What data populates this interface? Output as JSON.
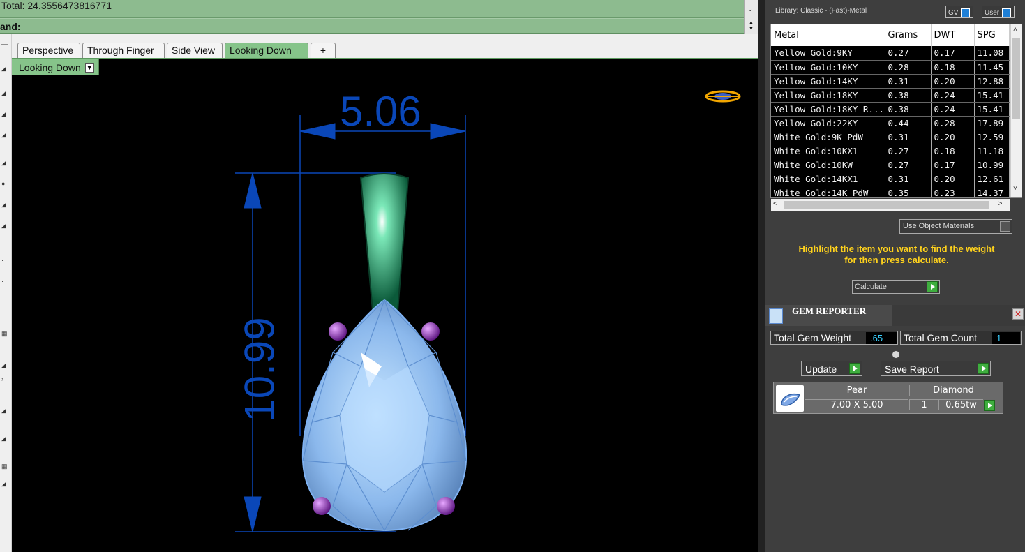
{
  "command_history": {
    "text": "Total: 24.3556473816771"
  },
  "command_line": {
    "label": "and:",
    "value": ""
  },
  "view_tabs": [
    {
      "label": "Perspective",
      "active": false
    },
    {
      "label": "Through Finger",
      "active": false
    },
    {
      "label": "Side View",
      "active": false
    },
    {
      "label": "Looking Down",
      "active": true
    },
    {
      "label": "+",
      "active": false
    }
  ],
  "viewport": {
    "label": "Looking Down",
    "dimension_width": "5.06",
    "dimension_height": "10.99"
  },
  "library": {
    "title": "Library: Classic - (Fast)-Metal",
    "gv_label": "GV",
    "user_label": "User"
  },
  "metal_table": {
    "columns": [
      "Metal",
      "Grams",
      "DWT",
      "SPG"
    ],
    "rows": [
      [
        "Yellow Gold:9KY",
        "0.27",
        "0.17",
        "11.08"
      ],
      [
        "Yellow Gold:10KY",
        "0.28",
        "0.18",
        "11.45"
      ],
      [
        "Yellow Gold:14KY",
        "0.31",
        "0.20",
        "12.88"
      ],
      [
        "Yellow Gold:18KY",
        "0.38",
        "0.24",
        "15.41"
      ],
      [
        "Yellow Gold:18KY R...",
        "0.38",
        "0.24",
        "15.41"
      ],
      [
        "Yellow Gold:22KY",
        "0.44",
        "0.28",
        "17.89"
      ],
      [
        "White Gold:9K PdW",
        "0.31",
        "0.20",
        "12.59"
      ],
      [
        "White Gold:10KX1",
        "0.27",
        "0.18",
        "11.18"
      ],
      [
        "White Gold:10KW",
        "0.27",
        "0.17",
        "10.99"
      ],
      [
        "White Gold:14KX1",
        "0.31",
        "0.20",
        "12.61"
      ],
      [
        "White Gold:14K PdW",
        "0.35",
        "0.23",
        "14.37"
      ]
    ]
  },
  "use_object_materials": "Use Object Materials",
  "hint": {
    "line1": "Highlight the item you want to find the weight",
    "line2": "for then press calculate."
  },
  "calculate_label": "Calculate",
  "gem_reporter": {
    "title": "GEM REPORTER",
    "total_weight_label": "Total Gem Weight",
    "total_weight_value": ".65",
    "total_count_label": "Total Gem Count",
    "total_count_value": "1",
    "update_label": "Update",
    "save_report_label": "Save Report",
    "gem": {
      "shape": "Pear",
      "size": "7.00 X 5.00",
      "material": "Diamond",
      "count": "1",
      "weight": "0.65tw"
    }
  },
  "colors": {
    "command_green": "#8dbb8f",
    "active_tab_green": "#86c48a",
    "dimension_blue": "#0a47b8",
    "hint_yellow": "#ffd21c",
    "gem_blue": "#9ec8f5",
    "bail_green": "#0e7a4e",
    "prong_purple": "#8b2fb3"
  }
}
